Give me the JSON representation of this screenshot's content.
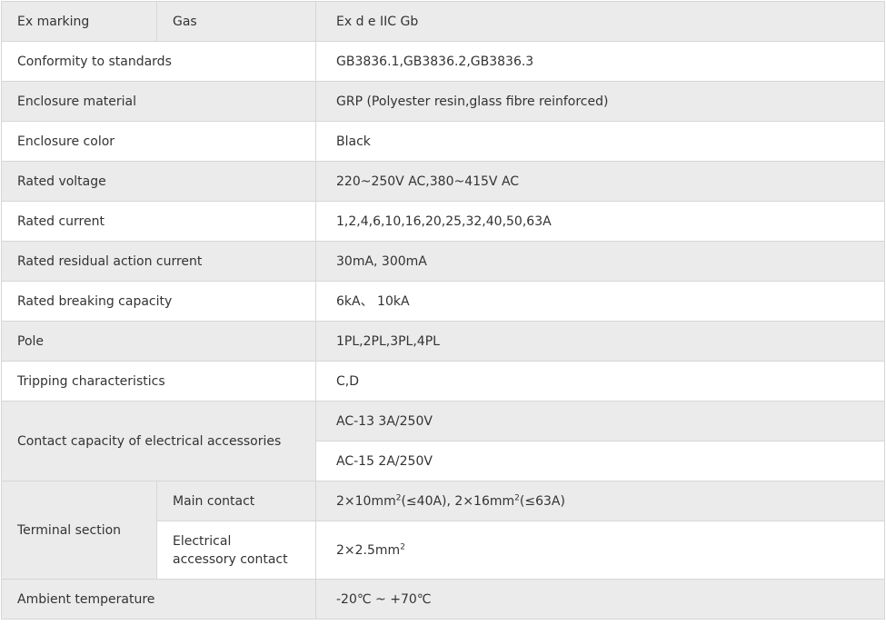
{
  "rows": [
    {
      "label": "Ex marking",
      "sub": "Gas",
      "value": "Ex d e IIC Gb"
    },
    {
      "label": "Conformity to standards",
      "value": "GB3836.1,GB3836.2,GB3836.3"
    },
    {
      "label": "Enclosure material",
      "value": "GRP (Polyester resin,glass fibre reinforced)"
    },
    {
      "label": "Enclosure color",
      "value": "Black"
    },
    {
      "label": "Rated voltage",
      "value": "220~250V AC,380~415V AC"
    },
    {
      "label": "Rated current",
      "value": "1,2,4,6,10,16,20,25,32,40,50,63A"
    },
    {
      "label": "Rated residual action current",
      "value": "30mA, 300mA"
    },
    {
      "label": "Rated breaking capacity",
      "value": "6kA、 10kA"
    },
    {
      "label": "Pole",
      "value": "1PL,2PL,3PL,4PL"
    },
    {
      "label": "Tripping characteristics",
      "value": "C,D"
    },
    {
      "label": "Contact capacity of electrical accessories",
      "values": [
        "AC-13 3A/250V",
        "AC-15 2A/250V"
      ]
    },
    {
      "label": "Terminal section",
      "subs": [
        {
          "label": "Main contact",
          "value_a": "2×10mm",
          "sup_a": "2",
          "value_b": "(≤40A), 2×16mm",
          "sup_b": "2",
          "value_c": "(≤63A)"
        },
        {
          "label": "Electrical accessory  contact",
          "value_a": "2×2.5mm",
          "sup_a": "2"
        }
      ]
    },
    {
      "label": "Ambient temperature",
      "value": "-20℃ ~ +70℃"
    }
  ]
}
